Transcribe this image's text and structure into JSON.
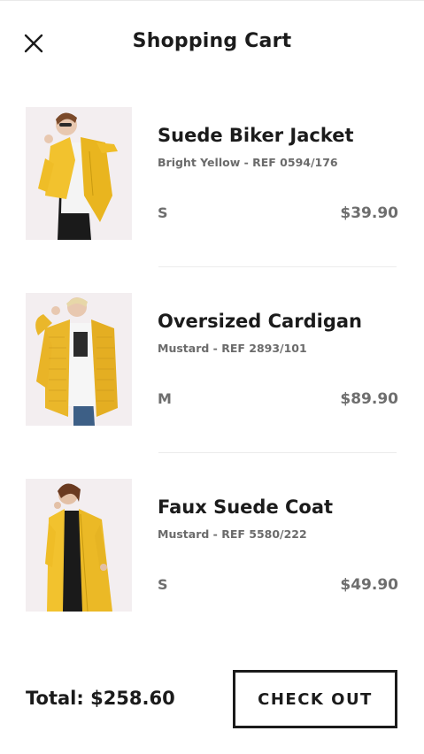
{
  "header": {
    "title": "Shopping Cart",
    "close_icon": "close-icon"
  },
  "cart": {
    "items": [
      {
        "name": "Suede Biker Jacket",
        "ref": "Bright Yellow - REF 0594/176",
        "size": "S",
        "price": "$39.90",
        "image": "yellow-suede-biker-jacket-photo"
      },
      {
        "name": "Oversized Cardigan",
        "ref": "Mustard - REF 2893/101",
        "size": "M",
        "price": "$89.90",
        "image": "mustard-knit-cardigan-photo"
      },
      {
        "name": "Faux Suede Coat",
        "ref": "Mustard - REF 5580/222",
        "size": "S",
        "price": "$49.90",
        "image": "mustard-suede-coat-photo"
      }
    ]
  },
  "footer": {
    "total_label": "Total: $258.60",
    "checkout_label": "CHECK OUT"
  },
  "colors": {
    "text": "#1b1b1b",
    "muted": "#6e6e6e",
    "thumb_bg": "#f3eef0",
    "garment_yellow": "#f2c22e"
  }
}
